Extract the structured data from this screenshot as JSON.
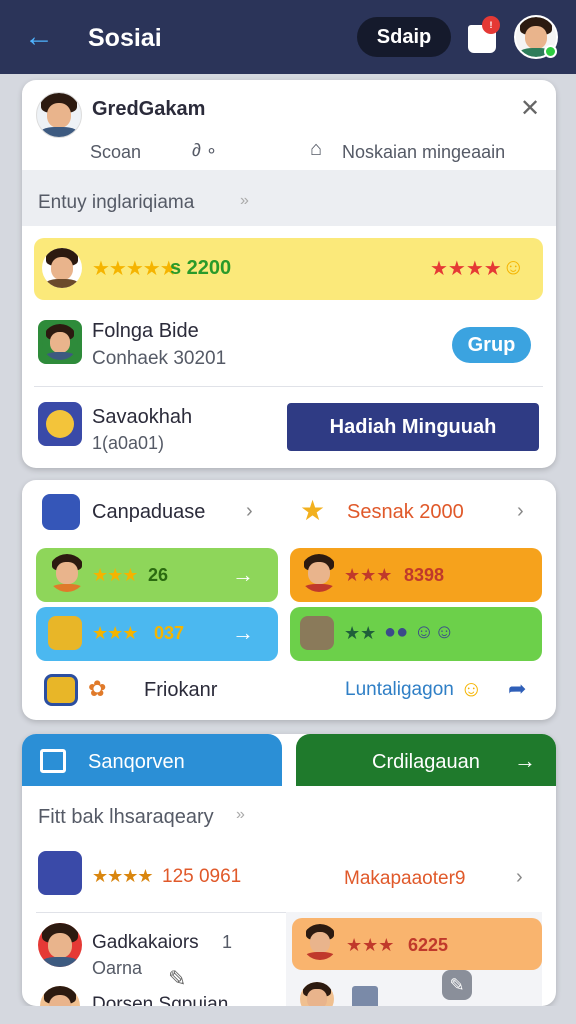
{
  "header": {
    "title": "Sosiai",
    "pill_label": "Sdaip",
    "badge": "!"
  },
  "card1": {
    "profile_name": "GredGakam",
    "sub_left": "Scoan",
    "sub_mid": "∂ ∘",
    "sub_right": "Noskaian mingeaain",
    "section_title": "Entuy inglariqiama",
    "highlight": {
      "stars": "★★★★★",
      "value": "s 2200"
    },
    "friend": {
      "name": "Folnga Bide",
      "sub": "Conhaek 30201"
    },
    "grup_button": "Grup",
    "item3": {
      "name": "Savaokhah",
      "sub": "1(a0a01)"
    },
    "hadiah_button": "Hadiah Minguuah"
  },
  "card2": {
    "left_title": "Canpaduase",
    "right_title": "Sesnak 2000",
    "tiles": [
      {
        "stars": "★★★",
        "value": "26",
        "color": "#8ed65a"
      },
      {
        "stars": "★★★",
        "value": "8398",
        "color": "#f6a21c"
      },
      {
        "stars": "★★★",
        "value": "037",
        "color": "#4bb8f0"
      },
      {
        "stars": "★★",
        "value": "●● ☺☺",
        "color": "#6cd04a"
      }
    ],
    "footer_left": "Friokanr",
    "footer_right": "Luntaligagon"
  },
  "card3": {
    "tab_left": "Sanqorven",
    "tab_right": "Crdilagauan",
    "section_title": "Fitt bak lhsaraqeary",
    "row1": {
      "stars": "★★★★",
      "value": "125 0961",
      "right": "Makapaaoter9"
    },
    "row2": {
      "name": "Gadkakaiors",
      "count": "1",
      "sub": "Oarna"
    },
    "row2_tile": {
      "stars": "★★★",
      "value": "6225"
    },
    "row3": {
      "name": "Dorsen Sqpuian"
    }
  },
  "colors": {
    "header": "#2b3459",
    "accent_blue": "#3ba3e0",
    "navy_button": "#2f3b84",
    "highlight_yellow": "#fbe97a"
  }
}
